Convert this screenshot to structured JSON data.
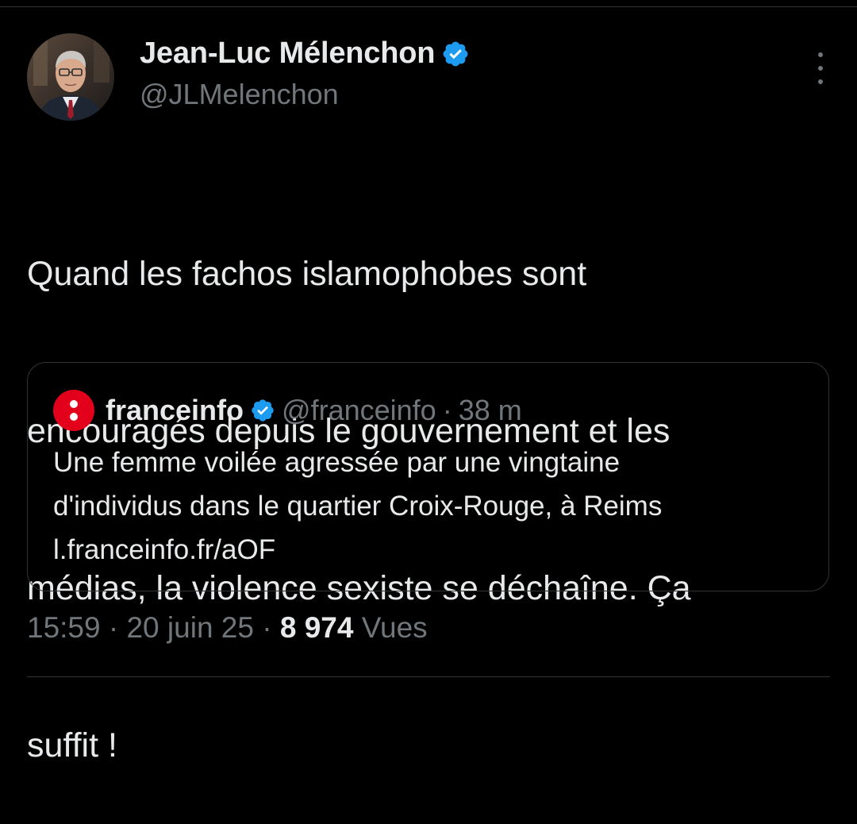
{
  "author": {
    "display_name": "Jean-Luc Mélenchon",
    "handle": "@JLMelenchon",
    "verified_icon": "verified-badge-icon",
    "avatar": "profile-photo"
  },
  "tweet": {
    "text_lines": [
      "Quand les fachos islamophobes sont",
      "encouragés depuis le gouvernement et les",
      "médias, la violence sexiste se déchaîne. Ça",
      "suffit !"
    ]
  },
  "quote": {
    "name": "franceinfo",
    "handle": "@franceinfo",
    "separator": "·",
    "time": "38 m",
    "text_lines": [
      "Une femme voilée agressée par une vingtaine",
      "d'individus dans le quartier Croix-Rouge, à Reims",
      "l.franceinfo.fr/aOF"
    ],
    "logo_color": "#e2001a"
  },
  "meta": {
    "time": "15:59",
    "sep1": "·",
    "date": "20 juin 25",
    "sep2": "·",
    "views_count": "8 974",
    "views_label": "Vues"
  },
  "colors": {
    "background": "#000000",
    "text": "#e7e9ea",
    "secondary": "#71767b",
    "border": "#2f3336",
    "verified": "#1d9bf0"
  }
}
